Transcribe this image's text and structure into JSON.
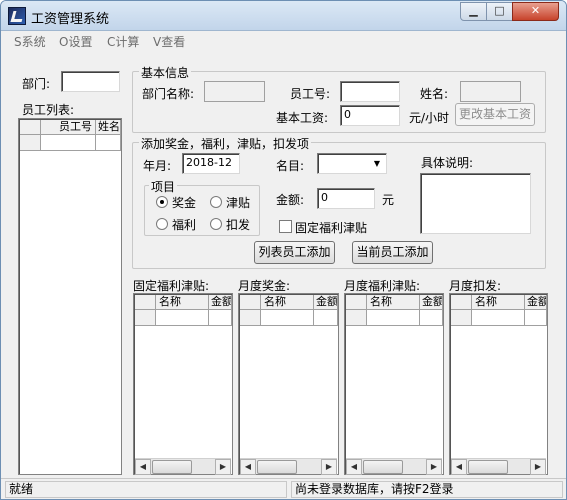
{
  "window": {
    "title": "工资管理系统"
  },
  "titlebar_buttons": {
    "minimize": "▁",
    "maximize": "□",
    "close": "✕"
  },
  "menu": [
    "S系统",
    "O设置",
    "C计算",
    "V查看"
  ],
  "left": {
    "dept_label": "部门:",
    "dept_value": "",
    "employee_list_label": "员工列表:",
    "columns": [
      "员工号",
      "姓名"
    ]
  },
  "basic_info": {
    "title": "基本信息",
    "dept_name_label": "部门名称:",
    "dept_name_value": "",
    "emp_no_label": "员工号:",
    "emp_no_value": "",
    "name_label": "姓名:",
    "name_value": "",
    "base_wage_label": "基本工资:",
    "base_wage_value": "0",
    "unit_label": "元/小时",
    "change_wage_button": "更改基本工资"
  },
  "add_item": {
    "title": "添加奖金，福利，津贴，扣发项",
    "year_month_label": "年月:",
    "year_month_value": "2018-12",
    "item_name_label": "名目:",
    "item_name_value": "",
    "detail_label": "具体说明:",
    "detail_value": "",
    "category_title": "项目",
    "radios": [
      "奖金",
      "津贴",
      "福利",
      "扣发"
    ],
    "selected_radio": "奖金",
    "amount_label": "金额:",
    "amount_value": "0",
    "amount_unit": "元",
    "fixed_welfare_label": "固定福利津贴",
    "fixed_welfare_checked": false,
    "add_listed_button": "列表员工添加",
    "add_current_button": "当前员工添加"
  },
  "tables": [
    {
      "label": "固定福利津贴:",
      "columns": [
        "名称",
        "金额"
      ]
    },
    {
      "label": "月度奖金:",
      "columns": [
        "名称",
        "金额"
      ]
    },
    {
      "label": "月度福利津贴:",
      "columns": [
        "名称",
        "金额"
      ]
    },
    {
      "label": "月度扣发:",
      "columns": [
        "名称",
        "金额"
      ]
    }
  ],
  "scroll_arrows": {
    "left": "◀",
    "right": "▶"
  },
  "status": {
    "left": "就绪",
    "right": "尚未登录数据库，请按F2登录"
  }
}
